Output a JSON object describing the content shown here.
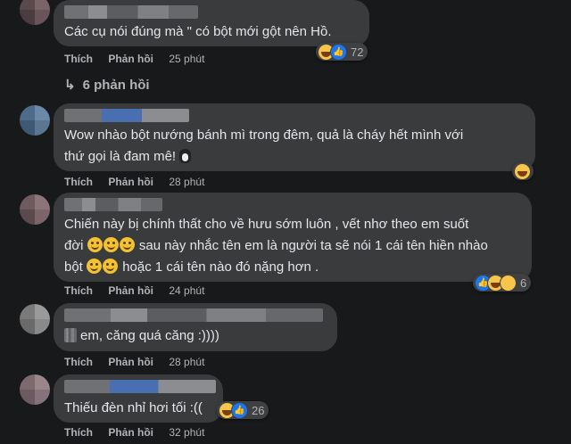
{
  "comments": [
    {
      "text_lines": [
        "Các cụ nói đúng mà \" có bột mới gột nên Hồ."
      ],
      "actions": {
        "like": "Thích",
        "reply": "Phản hồi",
        "time": "25 phút"
      },
      "reaction_count": "72",
      "reaction_icons": [
        "haha-icon",
        "like-icon"
      ]
    },
    {
      "text_lines": [
        "Wow nhào bột nướng bánh mì trong đêm, quả là cháy hết mình với",
        "thứ gọi là đam mê!"
      ],
      "actions": {
        "like": "Thích",
        "reply": "Phản hồi",
        "time": "28 phút"
      },
      "reaction_icons": [
        "haha-icon"
      ]
    },
    {
      "text_lines": [
        "Chiến này bị chính thất cho về hưu sớm luôn , vết nhơ theo em suốt",
        "đời",
        "sau này nhắc tên em là người ta sẽ nói 1 cái tên hiền nhào",
        "bột",
        "hoặc 1 cái tên nào đó nặng hơn ."
      ],
      "actions": {
        "like": "Thích",
        "reply": "Phản hồi",
        "time": "24 phút"
      },
      "reaction_count": "6",
      "reaction_icons": [
        "like-icon",
        "haha-icon",
        "sad-icon"
      ]
    },
    {
      "text_lines": [
        "em, căng quá căng :))))"
      ],
      "actions": {
        "like": "Thích",
        "reply": "Phản hồi",
        "time": "28 phút"
      }
    },
    {
      "text_lines": [
        "Thiếu đèn nhỉ hơi tối :(("
      ],
      "actions": {
        "like": "Thích",
        "reply": "Phản hồi",
        "time": "32 phút"
      },
      "reaction_count": "26",
      "reaction_icons": [
        "haha-icon",
        "like-icon"
      ]
    }
  ],
  "replies_link": {
    "arrow": "↳",
    "label": "6 phản hồi"
  },
  "colors": {
    "background": "#18191a",
    "bubble": "#3a3b3c",
    "text": "#e4e6eb",
    "muted": "#b0b3b8",
    "like_blue": "#1877f2"
  }
}
